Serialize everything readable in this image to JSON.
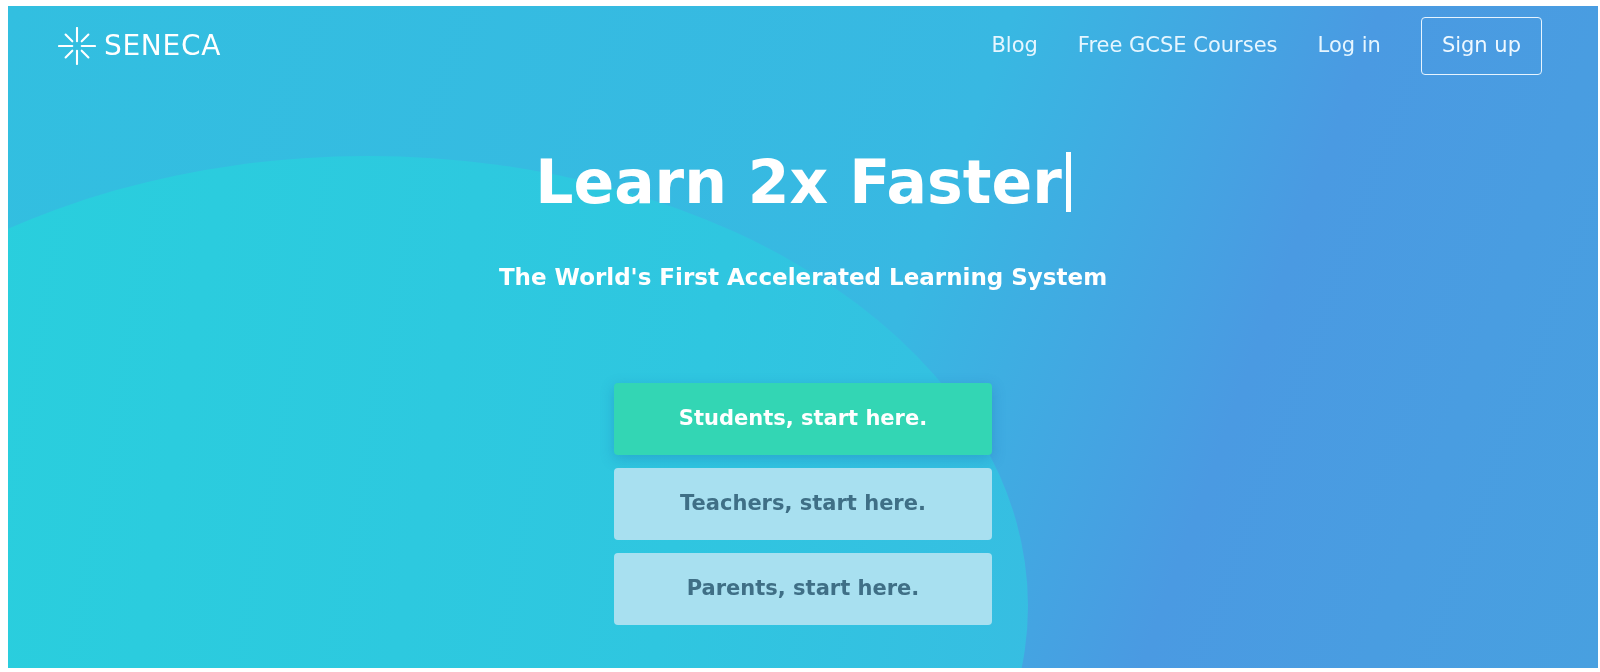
{
  "header": {
    "logo": "SENECA",
    "nav": [
      {
        "label": "Blog",
        "kind": "link"
      },
      {
        "label": "Free GCSE Courses",
        "kind": "link"
      },
      {
        "label": "Log in",
        "kind": "link"
      },
      {
        "label": "Sign up",
        "kind": "outlined"
      }
    ]
  },
  "hero": {
    "title": "Learn 2x Faster",
    "typing_cursor": true,
    "subtitle": "The World's First Accelerated Learning System",
    "buttons": [
      {
        "label": "Students, start here.",
        "kind": "primary"
      },
      {
        "label": "Teachers, start here.",
        "kind": "secondary"
      },
      {
        "label": "Parents, start here.",
        "kind": "secondary"
      }
    ]
  }
}
